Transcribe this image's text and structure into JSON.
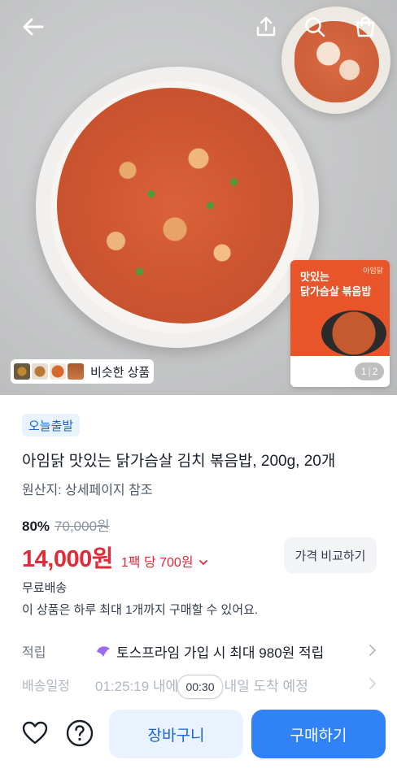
{
  "hero": {
    "similar_label": "비슷한 상품",
    "page_current": "1",
    "page_total": "2",
    "package": {
      "brand": "아임닭",
      "line1": "맛있는",
      "line2": "닭가슴살 볶음밥"
    }
  },
  "icons": {
    "back": "arrow-left-icon",
    "share": "share-icon",
    "search": "search-icon",
    "cart": "shopping-bag-icon",
    "heart": "heart-icon",
    "help": "question-icon"
  },
  "product": {
    "badge": "오늘출발",
    "title": "아임닭 맛있는 닭가슴살 김치 볶음밥, 200g, 20개",
    "origin": "원산지: 상세페이지 참조",
    "discount": "80%",
    "original_price": "70,000원",
    "price": "14,000원",
    "unit_price": "1팩 당 700원",
    "compare_label": "가격 비교하기",
    "shipping": "무료배송",
    "limit": "이 상품은 하루 최대 1개까지 구매할 수 있어요."
  },
  "rows": {
    "points_label": "적립",
    "points_value": "토스프라임 가입 시 최대 980원 적립",
    "delivery_label": "배송일정",
    "delivery_value": "01:25:19 내에 주문시 내일 도착 예정"
  },
  "timer": "00:30",
  "actions": {
    "cart_label": "장바구니",
    "buy_label": "구매하기"
  },
  "colors": {
    "accent": "#3182f6",
    "price_red": "#e42939",
    "badge_bg": "#e8f3ff"
  }
}
